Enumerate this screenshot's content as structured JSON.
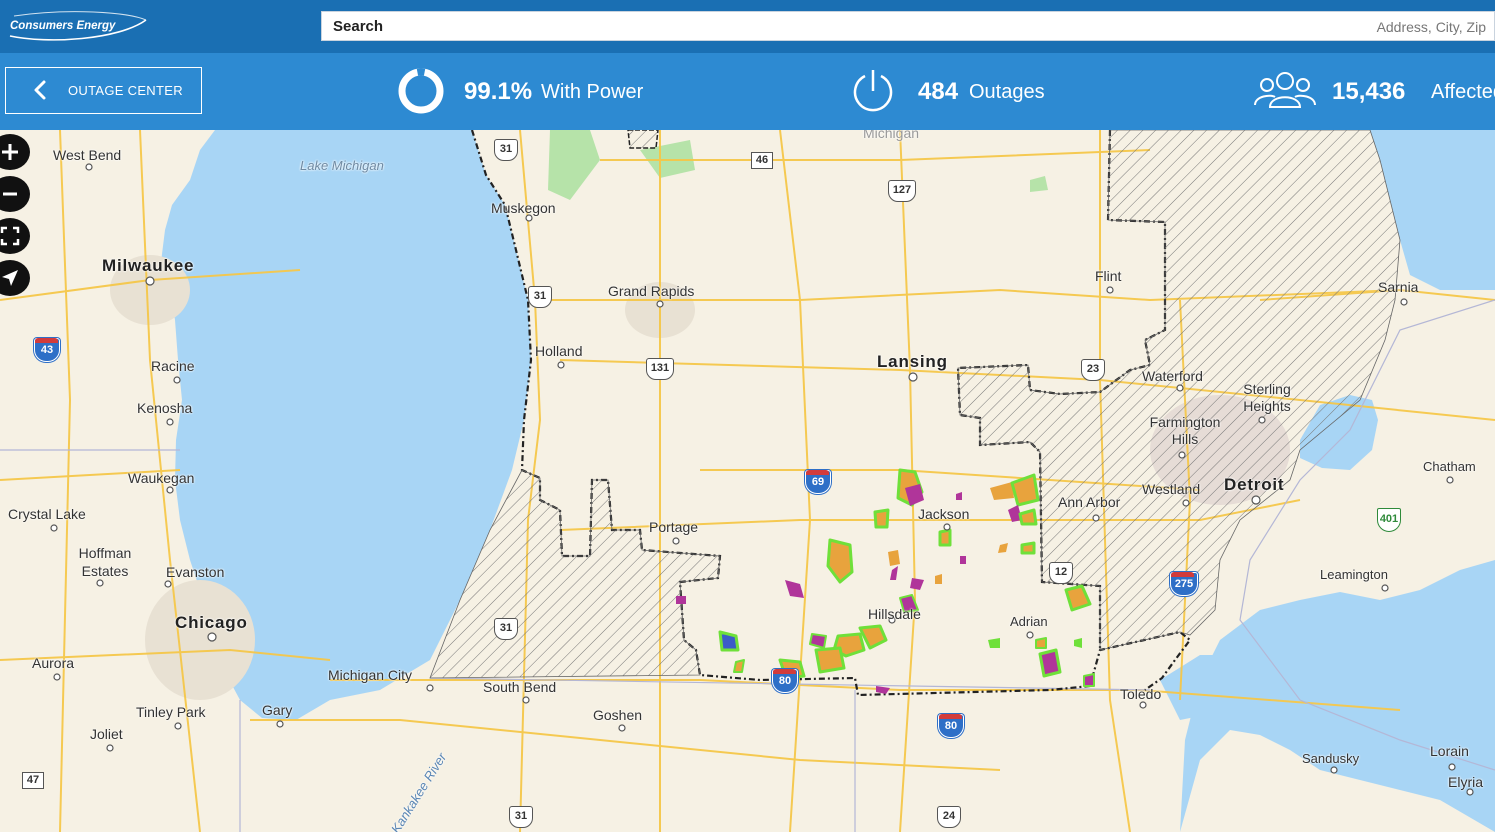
{
  "header": {
    "logo_text": "Consumers Energy",
    "search_label": "Search",
    "search_placeholder": "Address, City, Zip"
  },
  "status": {
    "back_label": "OUTAGE CENTER",
    "with_power_value": "99.1%",
    "with_power_label": "With Power",
    "with_power_fraction": 0.991,
    "outages_value": "484",
    "outages_label": "Outages",
    "affected_value": "15,436",
    "affected_label": "Affected"
  },
  "map_controls": {
    "zoom_in_icon": "plus-icon",
    "zoom_out_icon": "minus-icon",
    "fullscreen_icon": "fullscreen-icon",
    "locate_icon": "locate-arrow-icon"
  },
  "places": {
    "west_bend": "West Bend",
    "lake_michigan": "Lake Michigan",
    "milwaukee": "Milwaukee",
    "racine": "Racine",
    "kenosha": "Kenosha",
    "waukegan": "Waukegan",
    "crystal_lake": "Crystal Lake",
    "hoffman_estates": "Hoffman Estates",
    "evanston": "Evanston",
    "chicago": "Chicago",
    "aurora": "Aurora",
    "tinley_park": "Tinley Park",
    "joliet": "Joliet",
    "gary": "Gary",
    "kankakee_river": "Kankakee River",
    "muskegon": "Muskegon",
    "grand_rapids": "Grand Rapids",
    "holland": "Holland",
    "michigan": "Michigan",
    "lansing": "Lansing",
    "flint": "Flint",
    "sarnia": "Sarnia",
    "waterford": "Waterford",
    "sterling_heights": "Sterling Heights",
    "farmington_hills": "Farmington Hills",
    "detroit": "Detroit",
    "westland": "Westland",
    "ann_arbor": "Ann Arbor",
    "chatham": "Chatham",
    "jackson": "Jackson",
    "portage": "Portage",
    "hillsdale": "Hillsdale",
    "adrian": "Adrian",
    "leamington": "Leamington",
    "michigan_city": "Michigan City",
    "south_bend": "South Bend",
    "goshen": "Goshen",
    "toledo": "Toledo",
    "sandusky": "Sandusky",
    "lorain": "Lorain",
    "elyria": "Elyria"
  },
  "routes": {
    "us31_a": "31",
    "us31_b": "31",
    "us31_c": "31",
    "us31_d": "31",
    "m46": "46",
    "us127": "127",
    "us131": "131",
    "us23": "23",
    "us12": "12",
    "us24": "24",
    "i43": "43",
    "i69": "69",
    "i80_a": "80",
    "i80_b": "80",
    "i275": "275",
    "m47": "47",
    "on401": "401"
  },
  "colors": {
    "header_bg": "#1a6fb3",
    "status_bg": "#2d8ad2",
    "water": "#a8d5f5",
    "land": "#f6f1e4",
    "roads": "#f5c74a",
    "outage_orange": "#e8a33d",
    "outage_magenta": "#b0359a",
    "outage_green": "#6fe03a",
    "outage_blue": "#3b5cc8"
  }
}
